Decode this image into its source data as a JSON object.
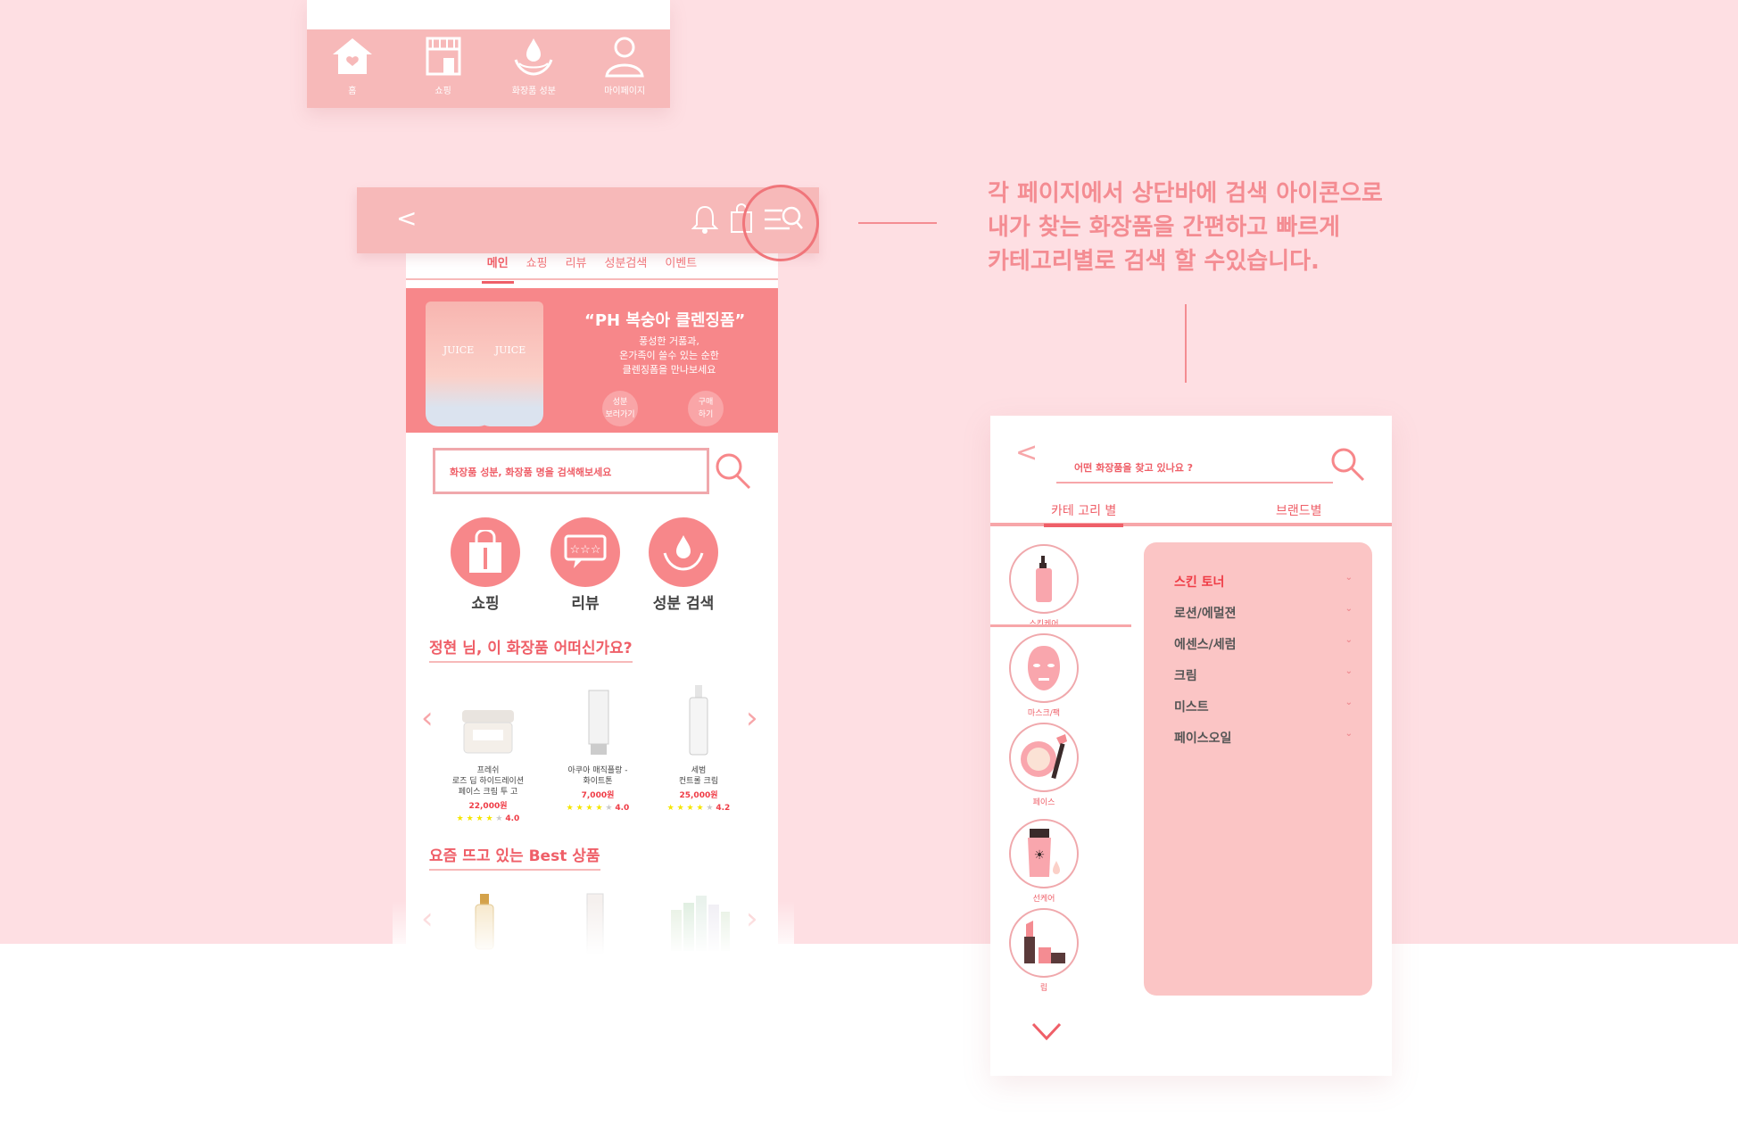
{
  "bottom_nav": {
    "items": [
      {
        "label": "홈",
        "icon": "home-icon"
      },
      {
        "label": "쇼핑",
        "icon": "shop-icon"
      },
      {
        "label": "화장품 성분",
        "icon": "ingredient-icon"
      },
      {
        "label": "마이페이지",
        "icon": "user-icon"
      }
    ]
  },
  "main_screen": {
    "topbar": {
      "back": "<"
    },
    "tabs": [
      "메인",
      "쇼핑",
      "리뷰",
      "성분검색",
      "이벤트"
    ],
    "banner": {
      "tube_label": "JUICE",
      "title": "“PH 복숭아 클렌징폼”",
      "desc_lines": [
        "풍성한 거품과,",
        "온가족이 쓸수 있는 순한",
        "클렌징폼을 만나보세요"
      ],
      "btn1": [
        "성분",
        "보러가기"
      ],
      "btn2": [
        "구매",
        "하기"
      ]
    },
    "search_placeholder": "화장품 성분, 화장품 명을 검색해보세요",
    "categories": [
      "쇼핑",
      "리뷰",
      "성분 검색"
    ],
    "recommend_title": "정현 님, 이 화장품 어떠신가요?",
    "products": [
      {
        "name": [
          "프레쉬",
          "로즈 딥 하이드레이션",
          "페이스 크림 투 고"
        ],
        "price": "22,000원",
        "rating": 4.0,
        "rating_text": "4.0"
      },
      {
        "name": [
          "아쿠아 매직플랑 -",
          "화이트톤"
        ],
        "price": "7,000원",
        "rating": 4.0,
        "rating_text": "4.0"
      },
      {
        "name": [
          "세범",
          "컨트롤 크림"
        ],
        "price": "25,000원",
        "rating": 4.2,
        "rating_text": "4.2"
      }
    ],
    "best_title": "요즘 뜨고 있는 Best 상품"
  },
  "annotation": {
    "lines": [
      "각 페이지에서  상단바에 검색 아이콘으로",
      "내가 찾는 화장품을 간편하고 빠르게",
      "카테고리별로 검색 할 수있습니다."
    ]
  },
  "search_screen": {
    "back": "<",
    "placeholder": "어떤 화장품을 찾고 있나요 ?",
    "tabs": [
      "카테 고리 별",
      "브랜드별"
    ],
    "side_categories": [
      "스킨케어",
      "마스크/팩",
      "페이스",
      "선케어",
      "립"
    ],
    "panel_items": [
      "스킨 토너",
      "로션/에멀젼",
      "에센스/세럼",
      "크림",
      "미스트",
      "페이스오일"
    ],
    "chevron": "⌄"
  },
  "colors": {
    "background": "#fedfe3",
    "accent": "#f7b9b9",
    "primary": "#ef5f68",
    "banner": "#f7878a"
  }
}
